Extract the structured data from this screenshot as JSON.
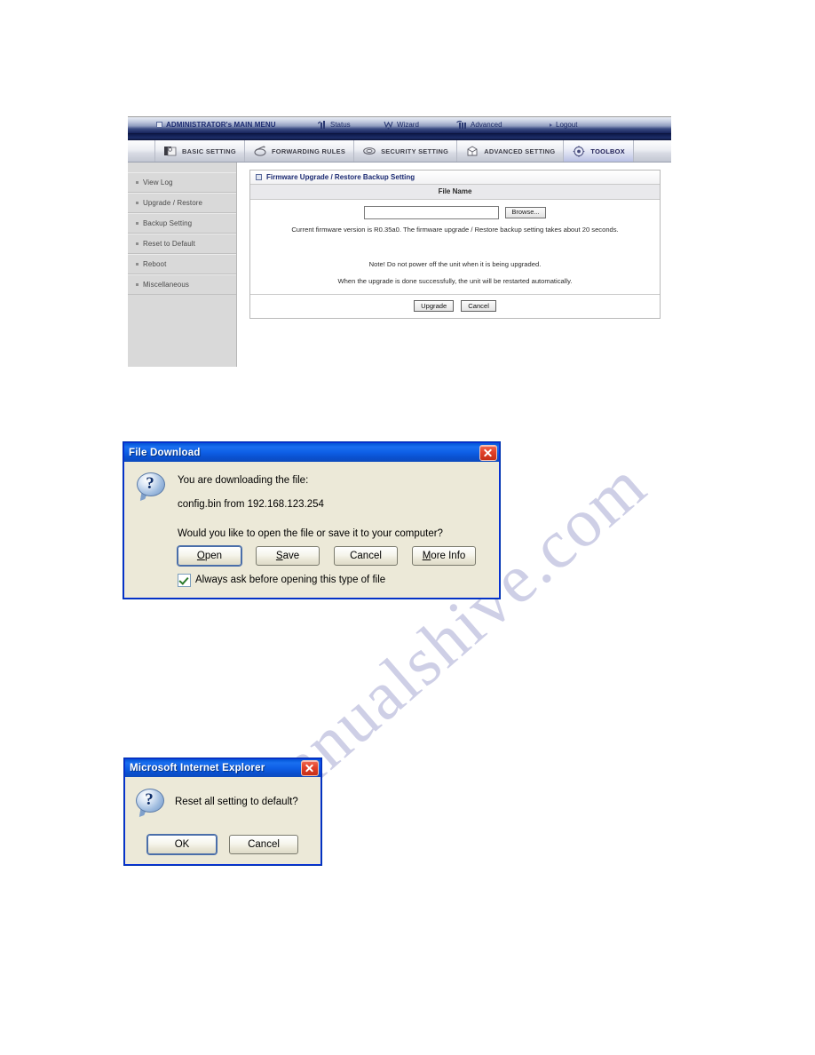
{
  "router_ui": {
    "top_nav": {
      "main_menu": "ADMINISTRATOR's MAIN MENU",
      "status": "Status",
      "wizard": "Wizard",
      "advanced": "Advanced",
      "logout": "Logout"
    },
    "tabs": [
      {
        "label": "BASIC SETTING",
        "icon": "basic-setting-icon",
        "active": false
      },
      {
        "label": "FORWARDING RULES",
        "icon": "forwarding-rules-icon",
        "active": false
      },
      {
        "label": "SECURITY SETTING",
        "icon": "security-setting-icon",
        "active": false
      },
      {
        "label": "ADVANCED SETTING",
        "icon": "advanced-setting-icon",
        "active": false
      },
      {
        "label": "TOOLBOX",
        "icon": "toolbox-icon",
        "active": true
      }
    ],
    "sidebar": {
      "items": [
        {
          "label": "View Log"
        },
        {
          "label": "Upgrade / Restore"
        },
        {
          "label": "Backup Setting"
        },
        {
          "label": "Reset to Default"
        },
        {
          "label": "Reboot"
        },
        {
          "label": "Miscellaneous"
        }
      ]
    },
    "panel": {
      "title": "Firmware Upgrade / Restore Backup Setting",
      "column_header": "File Name",
      "file_input_value": "",
      "browse_label": "Browse...",
      "info_line_1": "Current firmware version is R0.35a0. The firmware upgrade / Restore backup setting takes about 20 seconds.",
      "info_line_2": "Note! Do not power off the unit when it is being upgraded.",
      "info_line_3": "When the upgrade is done successfully, the unit will be restarted automatically.",
      "upgrade_label": "Upgrade",
      "cancel_label": "Cancel"
    }
  },
  "file_download_dialog": {
    "title": "File Download",
    "line_1": "You are downloading the file:",
    "line_2": "config.bin from 192.168.123.254",
    "question": "Would you like to open the file or save it to your computer?",
    "buttons": {
      "open": "Open",
      "save": "Save",
      "cancel": "Cancel",
      "more_info": "More Info"
    },
    "checkbox_label": "Always ask before opening this type of file",
    "checkbox_checked": true
  },
  "ie_dialog": {
    "title": "Microsoft Internet Explorer",
    "message": "Reset all setting to default?",
    "buttons": {
      "ok": "OK",
      "cancel": "Cancel"
    }
  },
  "watermark": {
    "text": "manualshive.com"
  },
  "colors": {
    "nav_dark_blue": "#16235c",
    "title_blue": "#1b2a72",
    "xp_titlebar": "#0a5fe0",
    "xp_dialog_face": "#ece9d8",
    "close_red": "#e2412a",
    "watermark": "#c6c7e2"
  }
}
